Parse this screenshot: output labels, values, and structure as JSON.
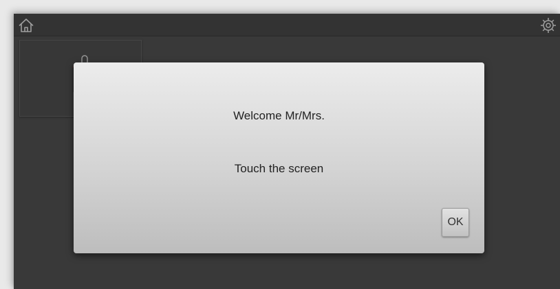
{
  "topbar": {
    "home_icon": "home-icon",
    "settings_icon": "gear-icon"
  },
  "tile": {
    "icon": "door-lock-icon"
  },
  "dialog": {
    "title": "Welcome Mr/Mrs.",
    "message": "Touch the screen",
    "ok_label": "OK"
  },
  "colors": {
    "background": "#3d3d3d",
    "topbar": "#363636",
    "dialog_top": "#ececec",
    "dialog_bottom": "#bdbdbd",
    "icon_stroke": "#9e9e9e"
  }
}
